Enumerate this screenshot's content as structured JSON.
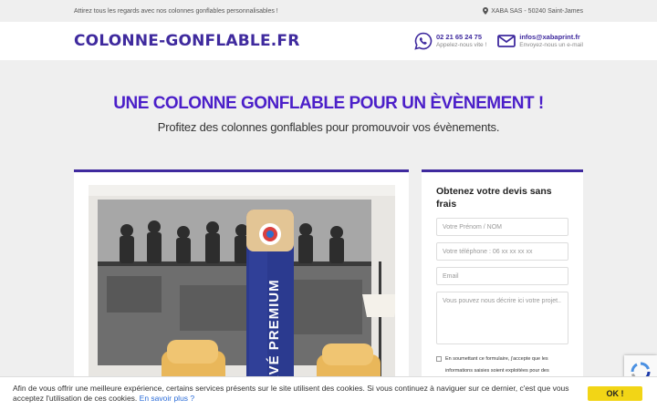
{
  "topbar": {
    "tagline": "Attirez tous les regards avec nos colonnes gonflables personnalisables !",
    "address": "XABA SAS - 50240 Saint-James"
  },
  "header": {
    "logo": "COLONNE-GONFLABLE.FR",
    "phone": {
      "number": "02 21 65 24 75",
      "caption": "Appelez-nous vite !",
      "icon": "whatsapp-phone-icon"
    },
    "email": {
      "address": "infos@xabaprint.fr",
      "caption": "Envoyez-nous un e-mail",
      "icon": "envelope-icon"
    }
  },
  "hero": {
    "title": "UNE COLONNE GONFLABLE POUR UN ÈVÈNEMENT !",
    "subtitle": "Profitez des colonnes gonflables pour promouvoir vos évènements."
  },
  "photo": {
    "column_text": "RVÉ PREMIUM"
  },
  "form": {
    "title": "Obtenez votre devis sans frais",
    "name_placeholder": "Votre Prénom / NOM",
    "phone_placeholder": "Votre téléphone : 06 xx xx xx xx",
    "email_placeholder": "Email",
    "message_placeholder": "Vous pouvez nous décrire ici votre projet..",
    "consent_text": "En soumettant ce formulaire, j'accepte que les informations saisies soient exploitées pour des"
  },
  "cookie": {
    "message": "Afin de vous offrir une meilleure expérience, certains services présents sur le site utilisent des cookies. Si vous continuez à naviguer sur ce dernier, c'est que vous acceptez l'utilisation de ces cookies.",
    "link_label": "En savoir plus ?",
    "ok_label": "OK !"
  },
  "colors": {
    "brand": "#3f2a9e",
    "title": "#4b1fc9",
    "cookie_button": "#f2d516",
    "link": "#2a6cd8"
  }
}
